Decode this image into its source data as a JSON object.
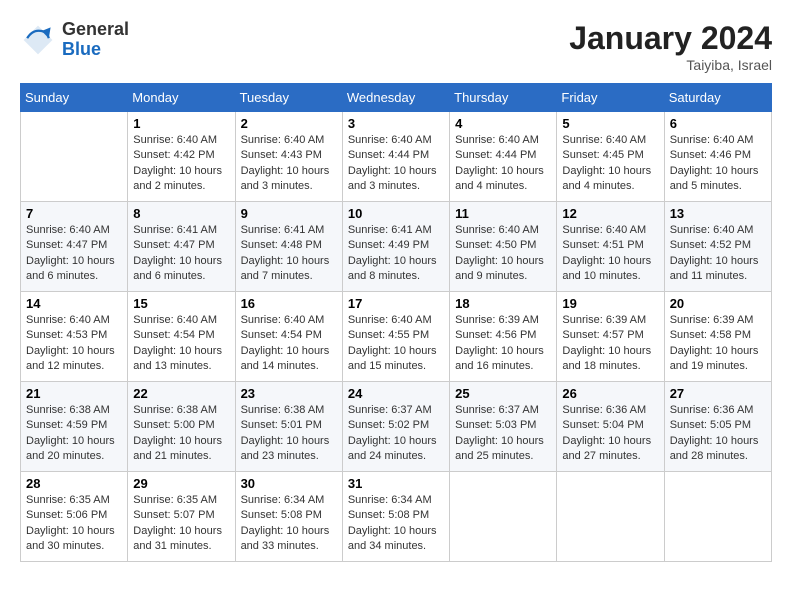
{
  "header": {
    "logo_general": "General",
    "logo_blue": "Blue",
    "month_title": "January 2024",
    "location": "Taiyiba, Israel"
  },
  "weekdays": [
    "Sunday",
    "Monday",
    "Tuesday",
    "Wednesday",
    "Thursday",
    "Friday",
    "Saturday"
  ],
  "weeks": [
    [
      {
        "day": "",
        "sunrise": "",
        "sunset": "",
        "daylight": ""
      },
      {
        "day": "1",
        "sunrise": "Sunrise: 6:40 AM",
        "sunset": "Sunset: 4:42 PM",
        "daylight": "Daylight: 10 hours and 2 minutes."
      },
      {
        "day": "2",
        "sunrise": "Sunrise: 6:40 AM",
        "sunset": "Sunset: 4:43 PM",
        "daylight": "Daylight: 10 hours and 3 minutes."
      },
      {
        "day": "3",
        "sunrise": "Sunrise: 6:40 AM",
        "sunset": "Sunset: 4:44 PM",
        "daylight": "Daylight: 10 hours and 3 minutes."
      },
      {
        "day": "4",
        "sunrise": "Sunrise: 6:40 AM",
        "sunset": "Sunset: 4:44 PM",
        "daylight": "Daylight: 10 hours and 4 minutes."
      },
      {
        "day": "5",
        "sunrise": "Sunrise: 6:40 AM",
        "sunset": "Sunset: 4:45 PM",
        "daylight": "Daylight: 10 hours and 4 minutes."
      },
      {
        "day": "6",
        "sunrise": "Sunrise: 6:40 AM",
        "sunset": "Sunset: 4:46 PM",
        "daylight": "Daylight: 10 hours and 5 minutes."
      }
    ],
    [
      {
        "day": "7",
        "sunrise": "Sunrise: 6:40 AM",
        "sunset": "Sunset: 4:47 PM",
        "daylight": "Daylight: 10 hours and 6 minutes."
      },
      {
        "day": "8",
        "sunrise": "Sunrise: 6:41 AM",
        "sunset": "Sunset: 4:47 PM",
        "daylight": "Daylight: 10 hours and 6 minutes."
      },
      {
        "day": "9",
        "sunrise": "Sunrise: 6:41 AM",
        "sunset": "Sunset: 4:48 PM",
        "daylight": "Daylight: 10 hours and 7 minutes."
      },
      {
        "day": "10",
        "sunrise": "Sunrise: 6:41 AM",
        "sunset": "Sunset: 4:49 PM",
        "daylight": "Daylight: 10 hours and 8 minutes."
      },
      {
        "day": "11",
        "sunrise": "Sunrise: 6:40 AM",
        "sunset": "Sunset: 4:50 PM",
        "daylight": "Daylight: 10 hours and 9 minutes."
      },
      {
        "day": "12",
        "sunrise": "Sunrise: 6:40 AM",
        "sunset": "Sunset: 4:51 PM",
        "daylight": "Daylight: 10 hours and 10 minutes."
      },
      {
        "day": "13",
        "sunrise": "Sunrise: 6:40 AM",
        "sunset": "Sunset: 4:52 PM",
        "daylight": "Daylight: 10 hours and 11 minutes."
      }
    ],
    [
      {
        "day": "14",
        "sunrise": "Sunrise: 6:40 AM",
        "sunset": "Sunset: 4:53 PM",
        "daylight": "Daylight: 10 hours and 12 minutes."
      },
      {
        "day": "15",
        "sunrise": "Sunrise: 6:40 AM",
        "sunset": "Sunset: 4:54 PM",
        "daylight": "Daylight: 10 hours and 13 minutes."
      },
      {
        "day": "16",
        "sunrise": "Sunrise: 6:40 AM",
        "sunset": "Sunset: 4:54 PM",
        "daylight": "Daylight: 10 hours and 14 minutes."
      },
      {
        "day": "17",
        "sunrise": "Sunrise: 6:40 AM",
        "sunset": "Sunset: 4:55 PM",
        "daylight": "Daylight: 10 hours and 15 minutes."
      },
      {
        "day": "18",
        "sunrise": "Sunrise: 6:39 AM",
        "sunset": "Sunset: 4:56 PM",
        "daylight": "Daylight: 10 hours and 16 minutes."
      },
      {
        "day": "19",
        "sunrise": "Sunrise: 6:39 AM",
        "sunset": "Sunset: 4:57 PM",
        "daylight": "Daylight: 10 hours and 18 minutes."
      },
      {
        "day": "20",
        "sunrise": "Sunrise: 6:39 AM",
        "sunset": "Sunset: 4:58 PM",
        "daylight": "Daylight: 10 hours and 19 minutes."
      }
    ],
    [
      {
        "day": "21",
        "sunrise": "Sunrise: 6:38 AM",
        "sunset": "Sunset: 4:59 PM",
        "daylight": "Daylight: 10 hours and 20 minutes."
      },
      {
        "day": "22",
        "sunrise": "Sunrise: 6:38 AM",
        "sunset": "Sunset: 5:00 PM",
        "daylight": "Daylight: 10 hours and 21 minutes."
      },
      {
        "day": "23",
        "sunrise": "Sunrise: 6:38 AM",
        "sunset": "Sunset: 5:01 PM",
        "daylight": "Daylight: 10 hours and 23 minutes."
      },
      {
        "day": "24",
        "sunrise": "Sunrise: 6:37 AM",
        "sunset": "Sunset: 5:02 PM",
        "daylight": "Daylight: 10 hours and 24 minutes."
      },
      {
        "day": "25",
        "sunrise": "Sunrise: 6:37 AM",
        "sunset": "Sunset: 5:03 PM",
        "daylight": "Daylight: 10 hours and 25 minutes."
      },
      {
        "day": "26",
        "sunrise": "Sunrise: 6:36 AM",
        "sunset": "Sunset: 5:04 PM",
        "daylight": "Daylight: 10 hours and 27 minutes."
      },
      {
        "day": "27",
        "sunrise": "Sunrise: 6:36 AM",
        "sunset": "Sunset: 5:05 PM",
        "daylight": "Daylight: 10 hours and 28 minutes."
      }
    ],
    [
      {
        "day": "28",
        "sunrise": "Sunrise: 6:35 AM",
        "sunset": "Sunset: 5:06 PM",
        "daylight": "Daylight: 10 hours and 30 minutes."
      },
      {
        "day": "29",
        "sunrise": "Sunrise: 6:35 AM",
        "sunset": "Sunset: 5:07 PM",
        "daylight": "Daylight: 10 hours and 31 minutes."
      },
      {
        "day": "30",
        "sunrise": "Sunrise: 6:34 AM",
        "sunset": "Sunset: 5:08 PM",
        "daylight": "Daylight: 10 hours and 33 minutes."
      },
      {
        "day": "31",
        "sunrise": "Sunrise: 6:34 AM",
        "sunset": "Sunset: 5:08 PM",
        "daylight": "Daylight: 10 hours and 34 minutes."
      },
      {
        "day": "",
        "sunrise": "",
        "sunset": "",
        "daylight": ""
      },
      {
        "day": "",
        "sunrise": "",
        "sunset": "",
        "daylight": ""
      },
      {
        "day": "",
        "sunrise": "",
        "sunset": "",
        "daylight": ""
      }
    ]
  ]
}
